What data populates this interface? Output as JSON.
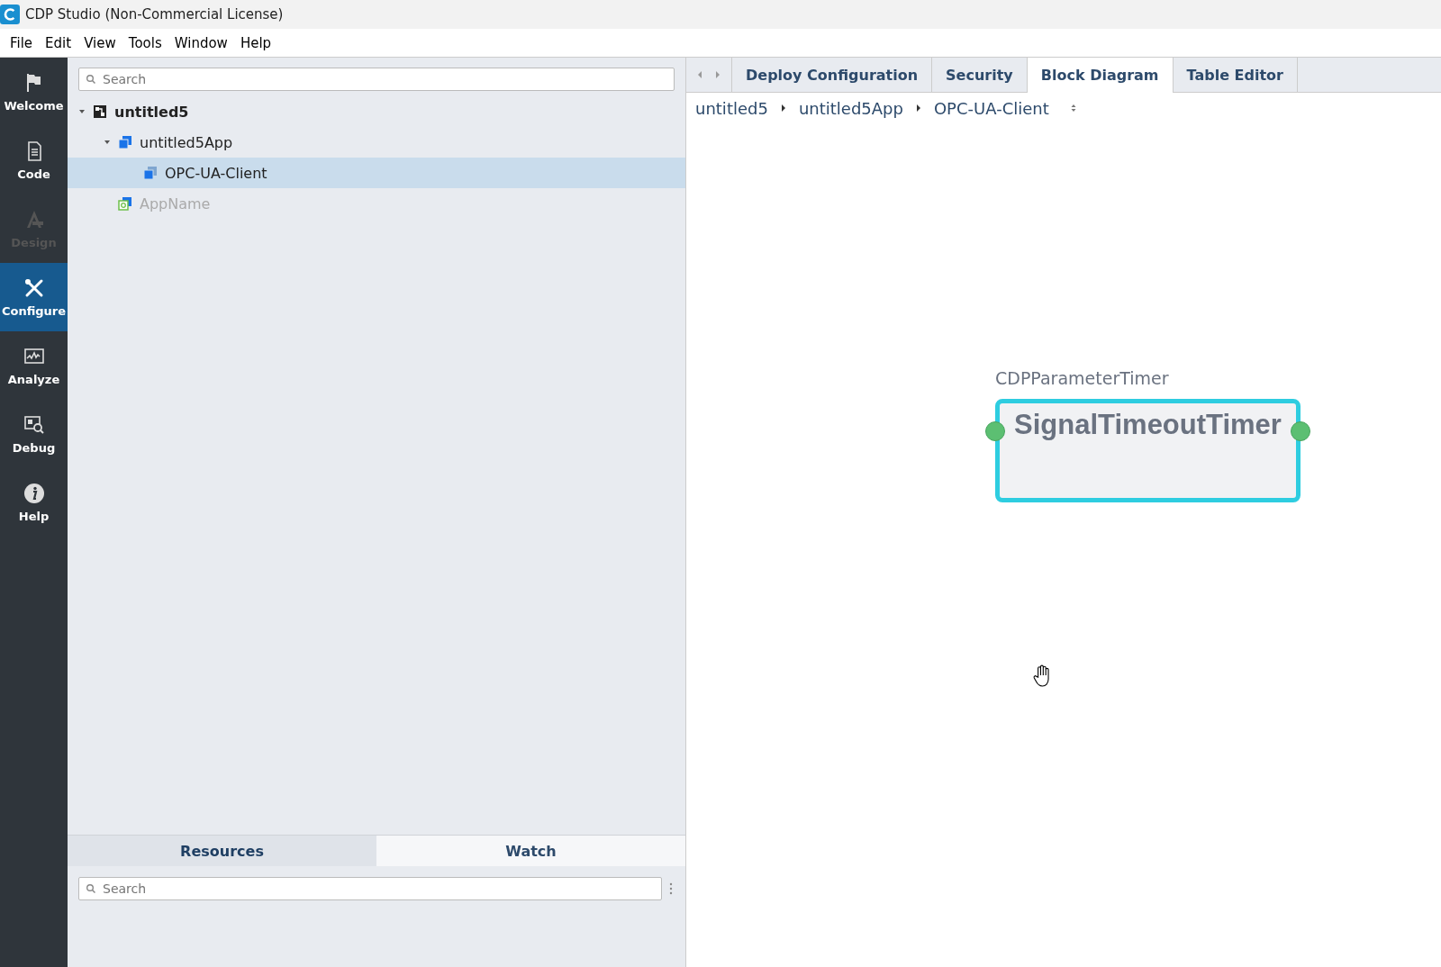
{
  "window": {
    "title": "CDP Studio (Non-Commercial License)"
  },
  "menu": [
    "File",
    "Edit",
    "View",
    "Tools",
    "Window",
    "Help"
  ],
  "modes": [
    {
      "label": "Welcome",
      "selected": false,
      "disabled": false
    },
    {
      "label": "Code",
      "selected": false,
      "disabled": false
    },
    {
      "label": "Design",
      "selected": false,
      "disabled": true
    },
    {
      "label": "Configure",
      "selected": true,
      "disabled": false
    },
    {
      "label": "Analyze",
      "selected": false,
      "disabled": false
    },
    {
      "label": "Debug",
      "selected": false,
      "disabled": false
    },
    {
      "label": "Help",
      "selected": false,
      "disabled": false
    }
  ],
  "project_tree": {
    "search": {
      "placeholder": "Search"
    },
    "items": [
      {
        "label": "untitled5",
        "kind": "system",
        "expanded": true,
        "selected": false,
        "disabled": false,
        "children": [
          {
            "label": "untitled5App",
            "kind": "app",
            "expanded": true,
            "selected": false,
            "disabled": false,
            "children": [
              {
                "label": "OPC-UA-Client",
                "kind": "component",
                "selected": true,
                "disabled": false
              }
            ]
          },
          {
            "label": "AppName",
            "kind": "qtapp",
            "selected": false,
            "disabled": true
          }
        ]
      }
    ]
  },
  "bottom_panel": {
    "tabs": [
      {
        "label": "Resources",
        "selected": true
      },
      {
        "label": "Watch",
        "selected": false
      }
    ],
    "search": {
      "placeholder": "Search"
    }
  },
  "editor": {
    "tabs": [
      {
        "label": "Deploy Configuration",
        "selected": false
      },
      {
        "label": "Security",
        "selected": false
      },
      {
        "label": "Block Diagram",
        "selected": true
      },
      {
        "label": "Table Editor",
        "selected": false
      }
    ],
    "breadcrumb": [
      "untitled5",
      "untitled5App",
      "OPC-UA-Client"
    ],
    "block": {
      "type": "CDPParameterTimer",
      "name": "SignalTimeoutTimer"
    }
  }
}
